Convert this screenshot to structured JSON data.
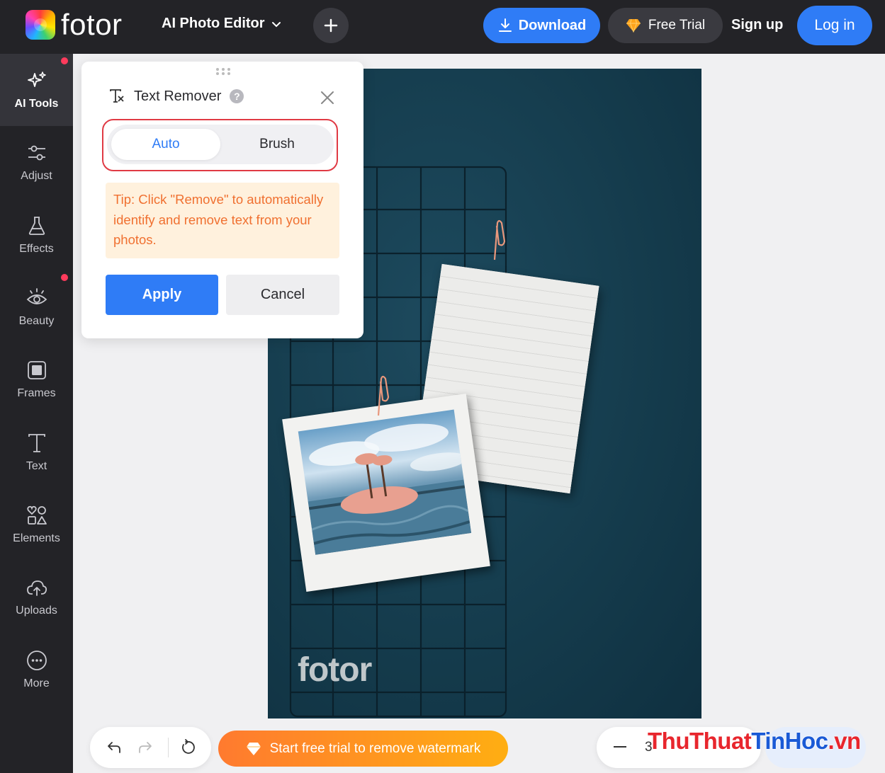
{
  "app": {
    "logo_text": "fotor",
    "menu_title": "AI Photo Editor"
  },
  "header": {
    "download_label": "Download",
    "free_trial_label": "Free Trial",
    "signup_label": "Sign up",
    "login_label": "Log in"
  },
  "sidebar": {
    "items": [
      {
        "label": "AI Tools",
        "icon": "sparkle-icon",
        "active": true,
        "badge": true
      },
      {
        "label": "Adjust",
        "icon": "sliders-icon"
      },
      {
        "label": "Effects",
        "icon": "flask-icon"
      },
      {
        "label": "Beauty",
        "icon": "eye-icon",
        "badge": true
      },
      {
        "label": "Frames",
        "icon": "frame-icon"
      },
      {
        "label": "Text",
        "icon": "text-icon"
      },
      {
        "label": "Elements",
        "icon": "shapes-icon"
      },
      {
        "label": "Uploads",
        "icon": "cloud-upload-icon"
      },
      {
        "label": "More",
        "icon": "more-icon"
      }
    ]
  },
  "panel": {
    "title": "Text Remover",
    "help": "?",
    "tabs": {
      "auto": "Auto",
      "brush": "Brush",
      "selected": "Auto"
    },
    "tip": "Tip: Click \"Remove\" to automatically identify and remove text from your photos.",
    "apply_label": "Apply",
    "cancel_label": "Cancel"
  },
  "canvas": {
    "watermark": "fotor"
  },
  "bottom": {
    "watermark_button": "Start free trial to remove watermark",
    "zoom_value": "3"
  },
  "overlay": {
    "site_mark_red": "ThuThuat",
    "site_mark_blue": "TinHoc",
    "site_mark_suffix": ".vn"
  },
  "colors": {
    "accent": "#2f7cf6",
    "topbar": "#232327",
    "highlight": "#e03a44",
    "tip_text": "#f07030"
  }
}
